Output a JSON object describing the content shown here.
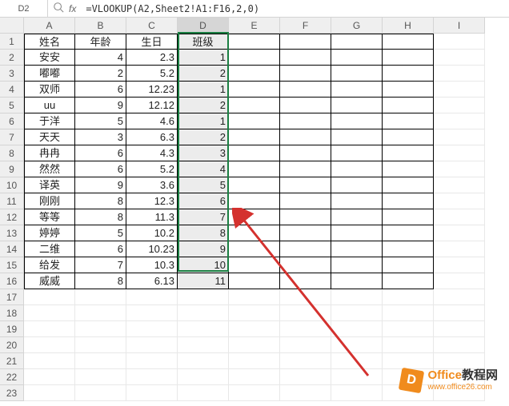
{
  "name_box": "D2",
  "fx_label": "fx",
  "formula": "=VLOOKUP(A2,Sheet2!A1:F16,2,0)",
  "columns": [
    "A",
    "B",
    "C",
    "D",
    "E",
    "F",
    "G",
    "H",
    "I"
  ],
  "row_count": 23,
  "headers": {
    "A": "姓名",
    "B": "年龄",
    "C": "生日",
    "D": "班级"
  },
  "rows": [
    {
      "A": "安安",
      "B": "4",
      "C": "2.3",
      "D": "1"
    },
    {
      "A": "嘟嘟",
      "B": "2",
      "C": "5.2",
      "D": "2"
    },
    {
      "A": "双师",
      "B": "6",
      "C": "12.23",
      "D": "1"
    },
    {
      "A": "uu",
      "B": "9",
      "C": "12.12",
      "D": "2"
    },
    {
      "A": "于洋",
      "B": "5",
      "C": "4.6",
      "D": "1"
    },
    {
      "A": "天天",
      "B": "3",
      "C": "6.3",
      "D": "2"
    },
    {
      "A": "冉冉",
      "B": "6",
      "C": "4.3",
      "D": "3"
    },
    {
      "A": "然然",
      "B": "6",
      "C": "5.2",
      "D": "4"
    },
    {
      "A": "译英",
      "B": "9",
      "C": "3.6",
      "D": "5"
    },
    {
      "A": "刚刚",
      "B": "8",
      "C": "12.3",
      "D": "6"
    },
    {
      "A": "等等",
      "B": "8",
      "C": "11.3",
      "D": "7"
    },
    {
      "A": "婷婷",
      "B": "5",
      "C": "10.2",
      "D": "8"
    },
    {
      "A": "二维",
      "B": "6",
      "C": "10.23",
      "D": "9"
    },
    {
      "A": "给发",
      "B": "7",
      "C": "10.3",
      "D": "10"
    },
    {
      "A": "威威",
      "B": "8",
      "C": "6.13",
      "D": "11"
    }
  ],
  "logo": {
    "icon": "D",
    "title_a": "Office",
    "title_b": "教程网",
    "url": "www.office26.com"
  }
}
